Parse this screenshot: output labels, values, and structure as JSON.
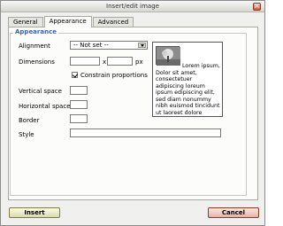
{
  "dialog": {
    "title": "Insert/edit image",
    "close_symbol": "×"
  },
  "tabs": [
    {
      "label": "General"
    },
    {
      "label": "Appearance",
      "active": true
    },
    {
      "label": "Advanced"
    }
  ],
  "appearance": {
    "legend": "Appearance",
    "alignment": {
      "label": "Alignment",
      "selected": "-- Not set --"
    },
    "dimensions": {
      "label": "Dimensions",
      "width": "",
      "height": "",
      "separator": "x",
      "unit": "px"
    },
    "constrain": {
      "label": "Constrain proportions",
      "checked": true
    },
    "vertical_space": {
      "label": "Vertical space",
      "value": ""
    },
    "horizontal_space": {
      "label": "Horizontal space",
      "value": ""
    },
    "border": {
      "label": "Border",
      "value": ""
    },
    "style": {
      "label": "Style",
      "value": ""
    },
    "preview_text": "Lorem ipsum, Dolor sit amet, consectetuer adipiscing loreum ipsum edipiscing elit, sed diam nonummy nibh euismod tincidunt ut laoreet dolore magna aliquam erat volutpat.Loreum ipsum"
  },
  "buttons": {
    "insert": "Insert",
    "cancel": "Cancel"
  }
}
